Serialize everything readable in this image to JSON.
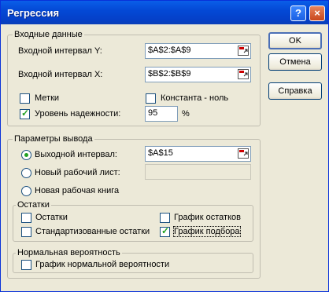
{
  "title": "Регрессия",
  "title_buttons": {
    "help": "?",
    "close": "×"
  },
  "input_group": {
    "legend": "Входные данные",
    "input_y_label": "Входной интервал Y:",
    "input_y_value": "$A$2:$A$9",
    "input_x_label": "Входной интервал X:",
    "input_x_value": "$B$2:$B$9",
    "labels_checkbox": {
      "label": "Метки",
      "checked": false
    },
    "constant_zero_checkbox": {
      "label": "Константа - ноль",
      "checked": false
    },
    "confidence_checkbox": {
      "label": "Уровень надежности:",
      "checked": true
    },
    "confidence_value": "95",
    "confidence_unit": "%"
  },
  "output_group": {
    "legend": "Параметры вывода",
    "output_range": {
      "label": "Выходной интервал:",
      "value": "$A$15",
      "selected": true
    },
    "new_sheet": {
      "label": "Новый рабочий лист:",
      "value": "",
      "selected": false
    },
    "new_workbook": {
      "label": "Новая рабочая книга",
      "selected": false
    }
  },
  "residuals_group": {
    "legend": "Остатки",
    "residuals": {
      "label": "Остатки",
      "checked": false
    },
    "standardized": {
      "label": "Стандартизованные остатки",
      "checked": false
    },
    "residual_plot": {
      "label": "График остатков",
      "checked": false
    },
    "line_fit_plot": {
      "label": "График подбора",
      "checked": true
    }
  },
  "normal_group": {
    "legend": "Нормальная вероятность",
    "normal_plot": {
      "label": "График нормальной вероятности",
      "checked": false
    }
  },
  "buttons": {
    "ok": "OK",
    "cancel": "Отмена",
    "help": "Справка"
  },
  "icons": {
    "range_picker": "range-picker-icon"
  }
}
